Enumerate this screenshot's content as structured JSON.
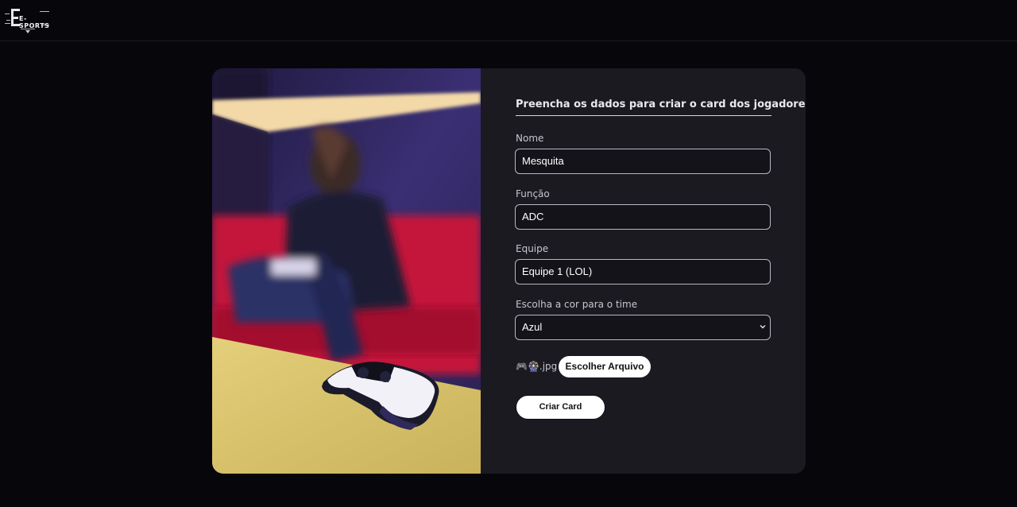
{
  "header": {
    "logo_text": "E-SPORTS"
  },
  "form": {
    "title": "Preencha os dados para criar o card dos jogadores:",
    "name_label": "Nome",
    "name_value": "Mesquita",
    "role_label": "Função",
    "role_value": "ADC",
    "team_label": "Equipe",
    "team_value": "Equipe 1 (LOL)",
    "color_label": "Escolha a cor para o time",
    "color_value": "Azul",
    "file_name": "🎮🎡.jpg",
    "file_button_label": "Escolher Arquivo",
    "submit_label": "Criar Card"
  },
  "colors": {
    "page_background": "#07060b",
    "card_background": "#1b1a21",
    "button_background": "#ffffff"
  },
  "icons": {
    "logo": "esports-logo",
    "select": "chevron-down-icon"
  }
}
